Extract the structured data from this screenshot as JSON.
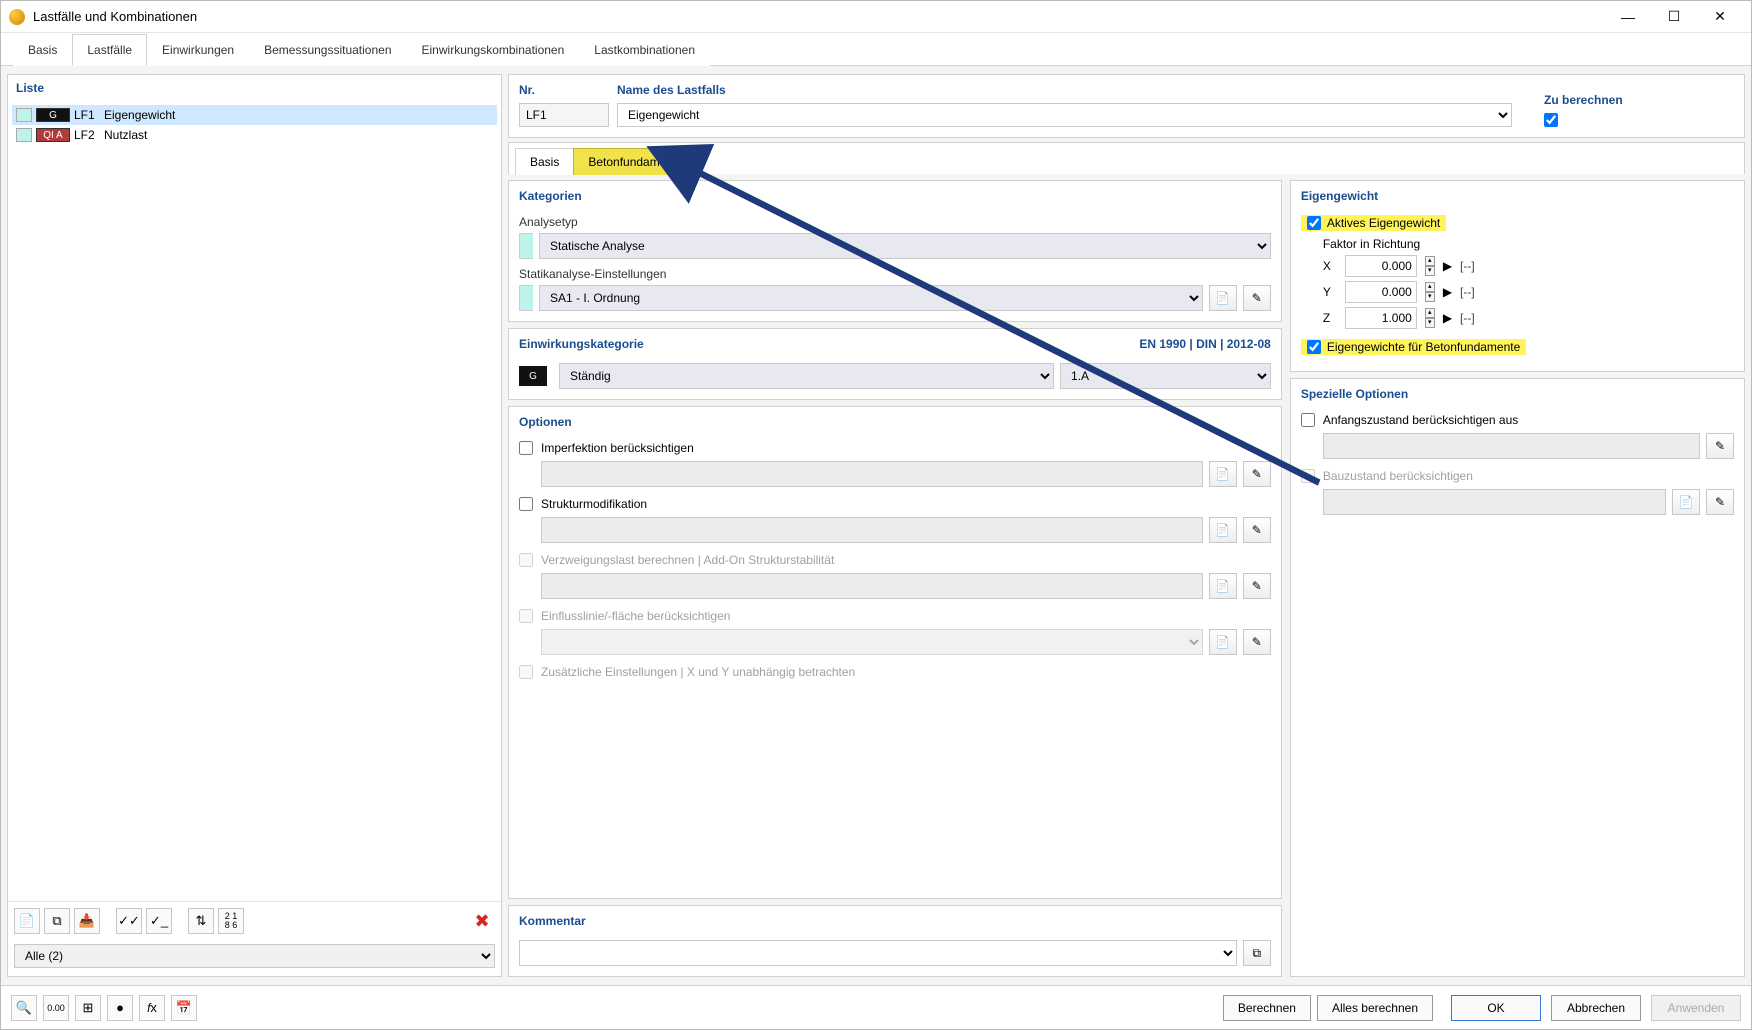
{
  "window": {
    "title": "Lastfälle und Kombinationen"
  },
  "maintabs": [
    "Basis",
    "Lastfälle",
    "Einwirkungen",
    "Bemessungssituationen",
    "Einwirkungskombinationen",
    "Lastkombinationen"
  ],
  "maintab_active": 1,
  "liste": {
    "header": "Liste",
    "items": [
      {
        "id": "LF1",
        "name": "Eigengewicht",
        "badge": "G",
        "badgeClass": "G",
        "selected": true
      },
      {
        "id": "LF2",
        "name": "Nutzlast",
        "badge": "QI A",
        "badgeClass": "QA",
        "selected": false
      }
    ],
    "filter": "Alle (2)"
  },
  "header_fields": {
    "nr_label": "Nr.",
    "nr_value": "LF1",
    "name_label": "Name des Lastfalls",
    "name_value": "Eigengewicht",
    "calc_label": "Zu berechnen"
  },
  "subtabs": {
    "basis": "Basis",
    "beton": "Betonfundamente"
  },
  "kategorien": {
    "title": "Kategorien",
    "analysetyp_label": "Analysetyp",
    "analysetyp_value": "Statische Analyse",
    "statik_label": "Statikanalyse-Einstellungen",
    "statik_value": "SA1 - I. Ordnung"
  },
  "einwirkung": {
    "title": "Einwirkungskategorie",
    "std": "EN 1990 | DIN | 2012-08",
    "value": "Ständig",
    "num": "1.A"
  },
  "optionen": {
    "title": "Optionen",
    "imperf": "Imperfektion berücksichtigen",
    "struktur": "Strukturmodifikation",
    "verzweig": "Verzweigungslast berechnen | Add-On Strukturstabilität",
    "einfluss": "Einflusslinie/-fläche berücksichtigen",
    "zusatz": "Zusätzliche Einstellungen | X und Y unabhängig betrachten"
  },
  "eigengewicht": {
    "title": "Eigengewicht",
    "aktiv": "Aktives Eigengewicht",
    "faktor_label": "Faktor in Richtung",
    "x": "0.000",
    "y": "0.000",
    "z": "1.000",
    "unit": "[--]",
    "beton_chk": "Eigengewichte für Betonfundamente"
  },
  "spezielle": {
    "title": "Spezielle Optionen",
    "anfang": "Anfangszustand berücksichtigen aus",
    "bauzustand": "Bauzustand berücksichtigen"
  },
  "kommentar": {
    "title": "Kommentar"
  },
  "buttons": {
    "berechnen": "Berechnen",
    "alles": "Alles berechnen",
    "ok": "OK",
    "abbrechen": "Abbrechen",
    "anwenden": "Anwenden"
  }
}
